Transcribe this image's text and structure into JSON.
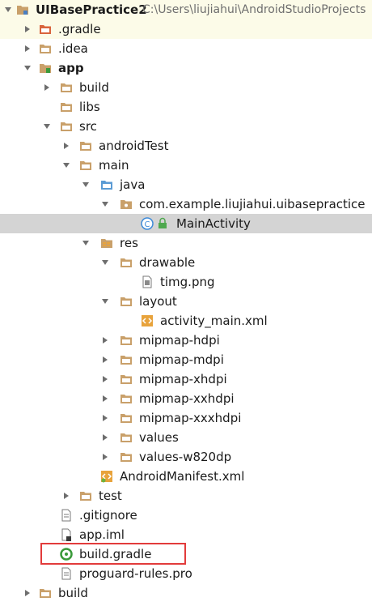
{
  "project": {
    "name": "UIBasePractice2",
    "path": "C:\\Users\\liujiahui\\AndroidStudioProjects"
  },
  "tree": {
    "gradle_dir": ".gradle",
    "idea_dir": ".idea",
    "app": "app",
    "app_build": "build",
    "libs": "libs",
    "src": "src",
    "androidTest": "androidTest",
    "main": "main",
    "java": "java",
    "package": "com.example.liujiahui.uibasepractice",
    "main_activity": "MainActivity",
    "res": "res",
    "drawable": "drawable",
    "timg": "timg.png",
    "layout": "layout",
    "activity_main": "activity_main.xml",
    "mipmap_hdpi": "mipmap-hdpi",
    "mipmap_mdpi": "mipmap-mdpi",
    "mipmap_xhdpi": "mipmap-xhdpi",
    "mipmap_xxhdpi": "mipmap-xxhdpi",
    "mipmap_xxxhdpi": "mipmap-xxxhdpi",
    "values": "values",
    "values_w820dp": "values-w820dp",
    "manifest": "AndroidManifest.xml",
    "test": "test",
    "gitignore": ".gitignore",
    "app_iml": "app.iml",
    "build_gradle": "build.gradle",
    "proguard": "proguard-rules.pro",
    "root_build": "build"
  },
  "colors": {
    "folder": "#c9a06a",
    "folder_red": "#d9643c",
    "folder_blue": "#5a9bd4",
    "selection": "#d4d4d4",
    "highlight_border": "#e23b3b",
    "class_icon": "#3d8ad8",
    "gradle_icon": "#3a9a3a"
  },
  "icons": {
    "expanded": "chevron-down-icon",
    "collapsed": "chevron-right-icon",
    "folder": "folder-icon",
    "file": "file-icon",
    "class": "class-icon",
    "gradle": "gradle-icon",
    "xml": "xml-file-icon",
    "image": "image-file-icon"
  }
}
